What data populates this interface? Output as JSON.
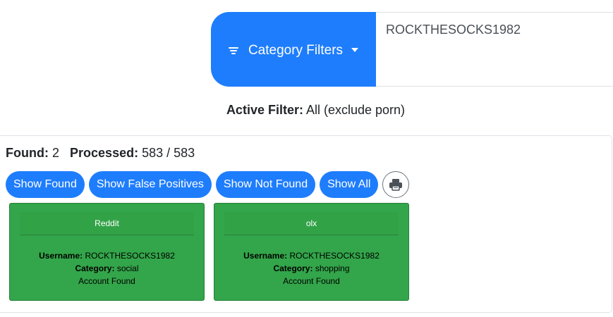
{
  "search": {
    "filter_button_label": "Category Filters",
    "query": "ROCKTHESOCKS1982"
  },
  "active_filter": {
    "label": "Active Filter:",
    "value": "All (exclude porn)"
  },
  "stats": {
    "found_label": "Found:",
    "found_value": "2",
    "processed_label": "Processed:",
    "processed_value": "583 / 583"
  },
  "buttons": {
    "show_found": "Show Found",
    "show_false_positives": "Show False Positives",
    "show_not_found": "Show Not Found",
    "show_all": "Show All"
  },
  "results": [
    {
      "site": "Reddit",
      "username_label": "Username:",
      "username": "ROCKTHESOCKS1982",
      "category_label": "Category:",
      "category": "social",
      "status": "Account Found"
    },
    {
      "site": "olx",
      "username_label": "Username:",
      "username": "ROCKTHESOCKS1982",
      "category_label": "Category:",
      "category": "shopping",
      "status": "Account Found"
    }
  ],
  "colors": {
    "primary": "#1e7dfc",
    "found_card": "#33a54a"
  },
  "icons": {
    "filter": "filter-lines-icon",
    "dropdown": "caret-down-icon",
    "print": "printer-icon"
  }
}
